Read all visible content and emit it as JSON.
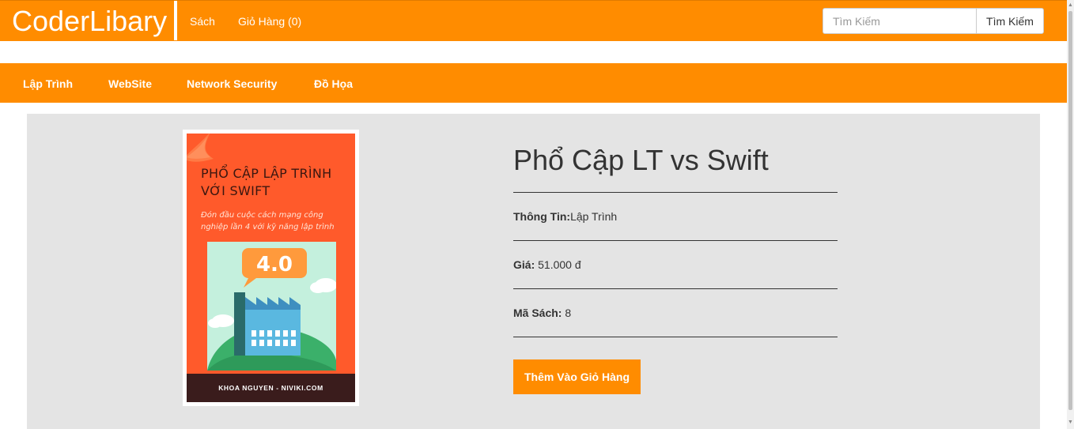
{
  "navbar": {
    "brand": "CoderLibary",
    "links": [
      "Sách",
      "Giỏ Hàng (0)"
    ],
    "search_placeholder": "Tìm Kiếm",
    "search_button": "Tìm Kiếm"
  },
  "categories": [
    "Lập Trình",
    "WebSite",
    "Network Security",
    "Đồ Họa"
  ],
  "book": {
    "cover": {
      "title_line1": "PHỔ CẬP LẬP TRÌNH",
      "title_line2": "VỚI SWIFT",
      "subtitle": "Đón đầu cuộc cách mạng công nghiệp lần 4 với kỹ năng lập trình",
      "badge": "4.0",
      "footer": "KHOA NGUYEN - NIVIKI.COM"
    },
    "title": "Phổ Cập LT vs Swift",
    "fields": [
      {
        "label": "Thông Tin:",
        "value": "Lập Trình"
      },
      {
        "label": "Giá:",
        "value": " 51.000 đ"
      },
      {
        "label": "Mã Sách:",
        "value": " 8"
      }
    ],
    "add_button": "Thêm Vào Giỏ Hàng"
  },
  "colors": {
    "accent": "#ff8c00",
    "panel": "#e4e4e4",
    "cover": "#ff5a2b"
  }
}
